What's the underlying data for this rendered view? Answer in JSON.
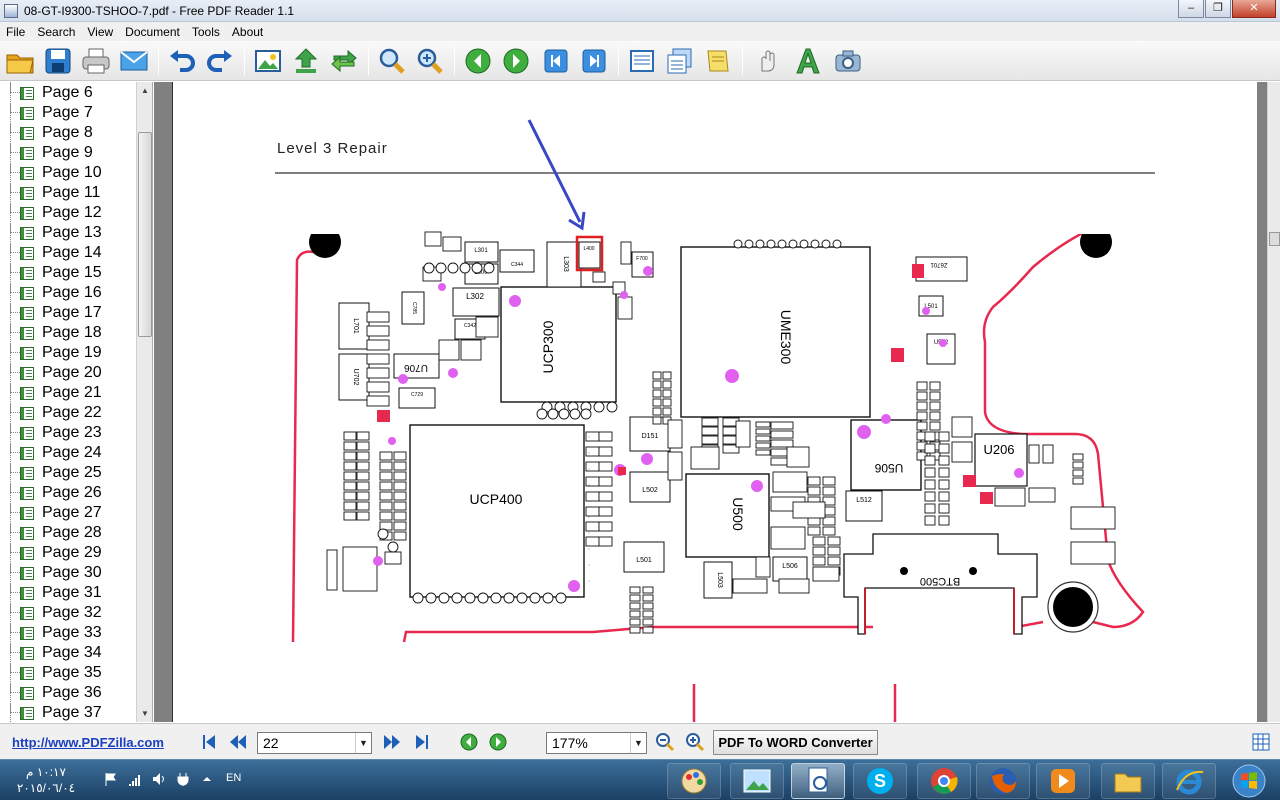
{
  "window": {
    "title": "08-GT-I9300-TSHOO-7.pdf - Free PDF Reader 1.1",
    "minimize": "–",
    "restore": "❐",
    "close": "✕"
  },
  "menu": [
    "File",
    "Search",
    "View",
    "Document",
    "Tools",
    "About"
  ],
  "toolbar_icons": [
    "open-folder-icon",
    "save-icon",
    "print-icon",
    "email-icon",
    "undo-icon",
    "redo-icon",
    "image-icon",
    "export-icon",
    "sync-icon",
    "zoom-in-icon",
    "zoom-out-icon",
    "back-icon",
    "forward-icon",
    "first-page-icon",
    "last-page-icon",
    "fit-width-icon",
    "multi-page-icon",
    "note-icon",
    "hand-icon",
    "text-icon",
    "camera-icon"
  ],
  "sidebar": {
    "pages": [
      "Page 6",
      "Page 7",
      "Page 8",
      "Page 9",
      "Page 10",
      "Page 11",
      "Page 12",
      "Page 13",
      "Page 14",
      "Page 15",
      "Page 16",
      "Page 17",
      "Page 18",
      "Page 19",
      "Page 20",
      "Page 21",
      "Page 22",
      "Page 23",
      "Page 24",
      "Page 25",
      "Page 26",
      "Page 27",
      "Page 28",
      "Page 29",
      "Page 30",
      "Page 31",
      "Page 32",
      "Page 33",
      "Page 34",
      "Page 35",
      "Page 36",
      "Page 37"
    ]
  },
  "document": {
    "heading": "Level 3 Repair",
    "labels": {
      "ucp300": "UCP300",
      "ucp400": "UCP400",
      "ume300": "UME300",
      "u500": "U500",
      "u506": "U506",
      "u206": "U206",
      "u706": "U706",
      "btc500": "BTC500",
      "l302": "L302",
      "l301": "L301",
      "l300": "L300",
      "l303": "L303",
      "l512": "L512",
      "l506": "L506",
      "l503": "L503",
      "l502": "L502",
      "l501": "L501",
      "d151": "D151",
      "f700": "F700",
      "l400": "L400",
      "u702": "U702",
      "l701": "L701",
      "z6701": "Z6701",
      "l501b": "L501",
      "u502": "U502",
      "c729": "C729",
      "c342": "C342",
      "c344": "C344",
      "c785": "C785"
    },
    "accent_color": "#e8284e",
    "arrow_color": "#3846c8",
    "via_color": "#e060f0"
  },
  "statusbar": {
    "link": "http://www.PDFZilla.com",
    "page_number": "22",
    "zoom": "177%",
    "convert_button": "PDF To WORD Converter"
  },
  "taskbar": {
    "time": "١٠:١٧ م",
    "date": "٢٠١٥/٠٦/٠٤",
    "language": "EN"
  }
}
